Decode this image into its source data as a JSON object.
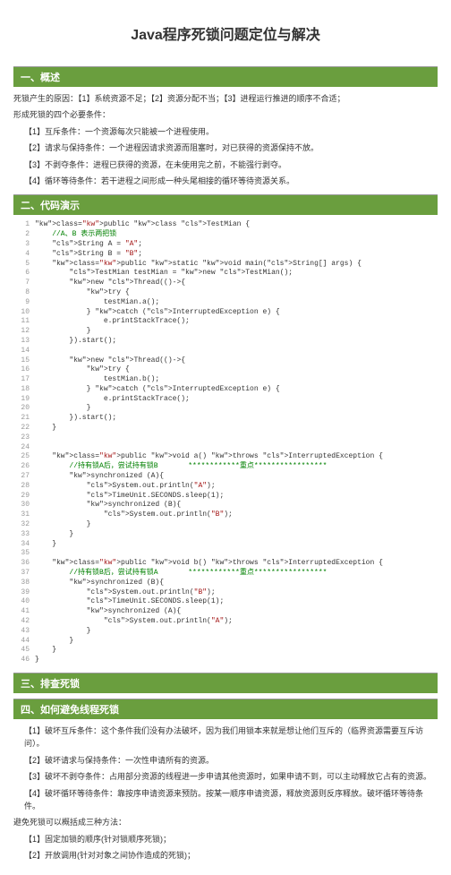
{
  "title": "Java程序死锁问题定位与解决",
  "s1": {
    "header": "一、概述",
    "intro": "死锁产生的原因：【1】系统资源不足；【2】资源分配不当；【3】进程运行推进的顺序不合适；",
    "condTitle": "形成死锁的四个必要条件：",
    "c1": "【1】互斥条件：一个资源每次只能被一个进程使用。",
    "c2": "【2】请求与保持条件：一个进程因请求资源而阻塞时，对已获得的资源保持不放。",
    "c3": "【3】不剥夺条件：进程已获得的资源，在未使用完之前，不能强行剥夺。",
    "c4": "【4】循环等待条件：若干进程之间形成一种头尾相接的循环等待资源关系。"
  },
  "s2": {
    "header": "二、代码演示"
  },
  "code": [
    {
      "n": "1",
      "t": "public class TestMian {",
      "cls": [
        "kw",
        "kw",
        "cls"
      ]
    },
    {
      "n": "2",
      "t": "    //A、B 表示两把锁",
      "c": "cmt"
    },
    {
      "n": "3",
      "t": "    String A = \"A\";"
    },
    {
      "n": "4",
      "t": "    String B = \"B\";"
    },
    {
      "n": "5",
      "t": "    public static void main(String[] args) {",
      "cls": [
        "kw",
        "kw",
        "kw"
      ]
    },
    {
      "n": "6",
      "t": "        TestMian testMian = new TestMian();",
      "cls": [
        "cls",
        "kw",
        "cls"
      ]
    },
    {
      "n": "7",
      "t": "        new Thread(()->{",
      "cls": [
        "kw",
        "cls"
      ]
    },
    {
      "n": "8",
      "t": "            try {",
      "cls": [
        "kw"
      ]
    },
    {
      "n": "9",
      "t": "                testMian.a();"
    },
    {
      "n": "10",
      "t": "            } catch (InterruptedException e) {",
      "cls": [
        "kw",
        "cls"
      ]
    },
    {
      "n": "11",
      "t": "                e.printStackTrace();"
    },
    {
      "n": "12",
      "t": "            }"
    },
    {
      "n": "13",
      "t": "        }).start();"
    },
    {
      "n": "14",
      "t": ""
    },
    {
      "n": "15",
      "t": "        new Thread(()->{",
      "cls": [
        "kw",
        "cls"
      ]
    },
    {
      "n": "16",
      "t": "            try {",
      "cls": [
        "kw"
      ]
    },
    {
      "n": "17",
      "t": "                testMian.b();"
    },
    {
      "n": "18",
      "t": "            } catch (InterruptedException e) {",
      "cls": [
        "kw",
        "cls"
      ]
    },
    {
      "n": "19",
      "t": "                e.printStackTrace();"
    },
    {
      "n": "20",
      "t": "            }"
    },
    {
      "n": "21",
      "t": "        }).start();"
    },
    {
      "n": "22",
      "t": "    }"
    },
    {
      "n": "23",
      "t": ""
    },
    {
      "n": "24",
      "t": ""
    },
    {
      "n": "25",
      "t": "    public void a() throws InterruptedException {",
      "cls": [
        "kw",
        "kw",
        "kw",
        "cls"
      ]
    },
    {
      "n": "26",
      "t": "        //持有锁A后，尝试持有锁B       ************重点*****************",
      "c": "cmt"
    },
    {
      "n": "27",
      "t": "        synchronized (A){",
      "cls": [
        "kw"
      ]
    },
    {
      "n": "28",
      "t": "            System.out.println(\"A\");"
    },
    {
      "n": "29",
      "t": "            TimeUnit.SECONDS.sleep(1);"
    },
    {
      "n": "30",
      "t": "            synchronized (B){",
      "cls": [
        "kw"
      ]
    },
    {
      "n": "31",
      "t": "                System.out.println(\"B\");"
    },
    {
      "n": "32",
      "t": "            }"
    },
    {
      "n": "33",
      "t": "        }"
    },
    {
      "n": "34",
      "t": "    }"
    },
    {
      "n": "35",
      "t": ""
    },
    {
      "n": "36",
      "t": "    public void b() throws InterruptedException {",
      "cls": [
        "kw",
        "kw",
        "kw",
        "cls"
      ]
    },
    {
      "n": "37",
      "t": "        //持有锁B后，尝试持有锁A       ************重点*****************",
      "c": "cmt"
    },
    {
      "n": "38",
      "t": "        synchronized (B){",
      "cls": [
        "kw"
      ]
    },
    {
      "n": "39",
      "t": "            System.out.println(\"B\");"
    },
    {
      "n": "40",
      "t": "            TimeUnit.SECONDS.sleep(1);"
    },
    {
      "n": "41",
      "t": "            synchronized (A){",
      "cls": [
        "kw"
      ]
    },
    {
      "n": "42",
      "t": "                System.out.println(\"A\");"
    },
    {
      "n": "43",
      "t": "            }"
    },
    {
      "n": "44",
      "t": "        }"
    },
    {
      "n": "45",
      "t": "    }"
    },
    {
      "n": "46",
      "t": "}"
    }
  ],
  "s3": {
    "header": "三、排查死锁"
  },
  "s4": {
    "header": "四、如何避免线程死锁",
    "c1": "【1】破坏互斥条件：这个条件我们没有办法破坏，因为我们用锁本来就是想让他们互斥的（临界资源需要互斥访问）。",
    "c2": "【2】破坏请求与保持条件：一次性申请所有的资源。",
    "c3": "【3】破坏不剥夺条件：占用部分资源的线程进一步申请其他资源时，如果申请不到，可以主动释放它占有的资源。",
    "c4": "【4】破坏循环等待条件：靠按序申请资源来预防。按某一顺序申请资源，释放资源则反序释放。破坏循环等待条件。",
    "avoidTitle": "避免死锁可以概括成三种方法：",
    "a1": "【1】固定加锁的顺序(针对锁顺序死锁)；",
    "a2": "【2】开放调用(针对对象之间协作造成的死锁)；"
  }
}
